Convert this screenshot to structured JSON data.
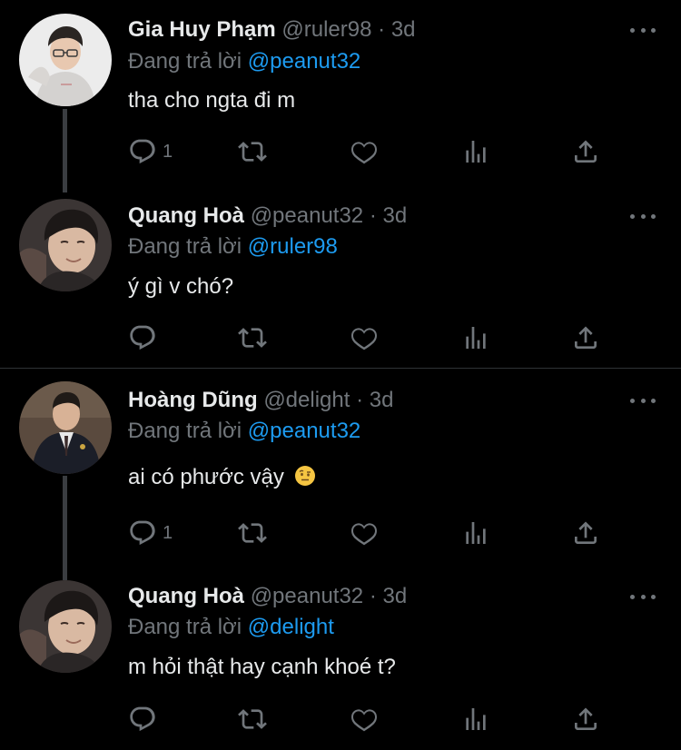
{
  "colors": {
    "background": "#000000",
    "text": "#e7e9ea",
    "muted": "#71767b",
    "accent": "#1d9bf0",
    "thread_line": "#3a3d41"
  },
  "icons": {
    "reply": "reply-icon",
    "retweet": "retweet-icon",
    "like": "heart-icon",
    "analytics": "analytics-icon",
    "share": "share-icon",
    "more": "more-dots-icon"
  },
  "tweets": [
    {
      "name": "Gia Huy Phạm",
      "handle": "@ruler98",
      "dot": "·",
      "time": "3d",
      "replying_prefix": "Đang trả lời",
      "replying_to": "@peanut32",
      "text": "tha cho ngta đi m",
      "reply_count": "1"
    },
    {
      "name": "Quang Hoà",
      "handle": "@peanut32",
      "dot": "·",
      "time": "3d",
      "replying_prefix": "Đang trả lời",
      "replying_to": "@ruler98",
      "text": "ý gì v chó?",
      "reply_count": ""
    },
    {
      "name": "Hoàng Dũng",
      "handle": "@delight",
      "dot": "·",
      "time": "3d",
      "replying_prefix": "Đang trả lời",
      "replying_to": "@peanut32",
      "text": "ai có phước vậy",
      "emoji": "raised-eyebrow-emoji",
      "reply_count": "1"
    },
    {
      "name": "Quang Hoà",
      "handle": "@peanut32",
      "dot": "·",
      "time": "3d",
      "replying_prefix": "Đang trả lời",
      "replying_to": "@delight",
      "text": "m hỏi thật hay cạnh khoé t?",
      "reply_count": ""
    }
  ]
}
